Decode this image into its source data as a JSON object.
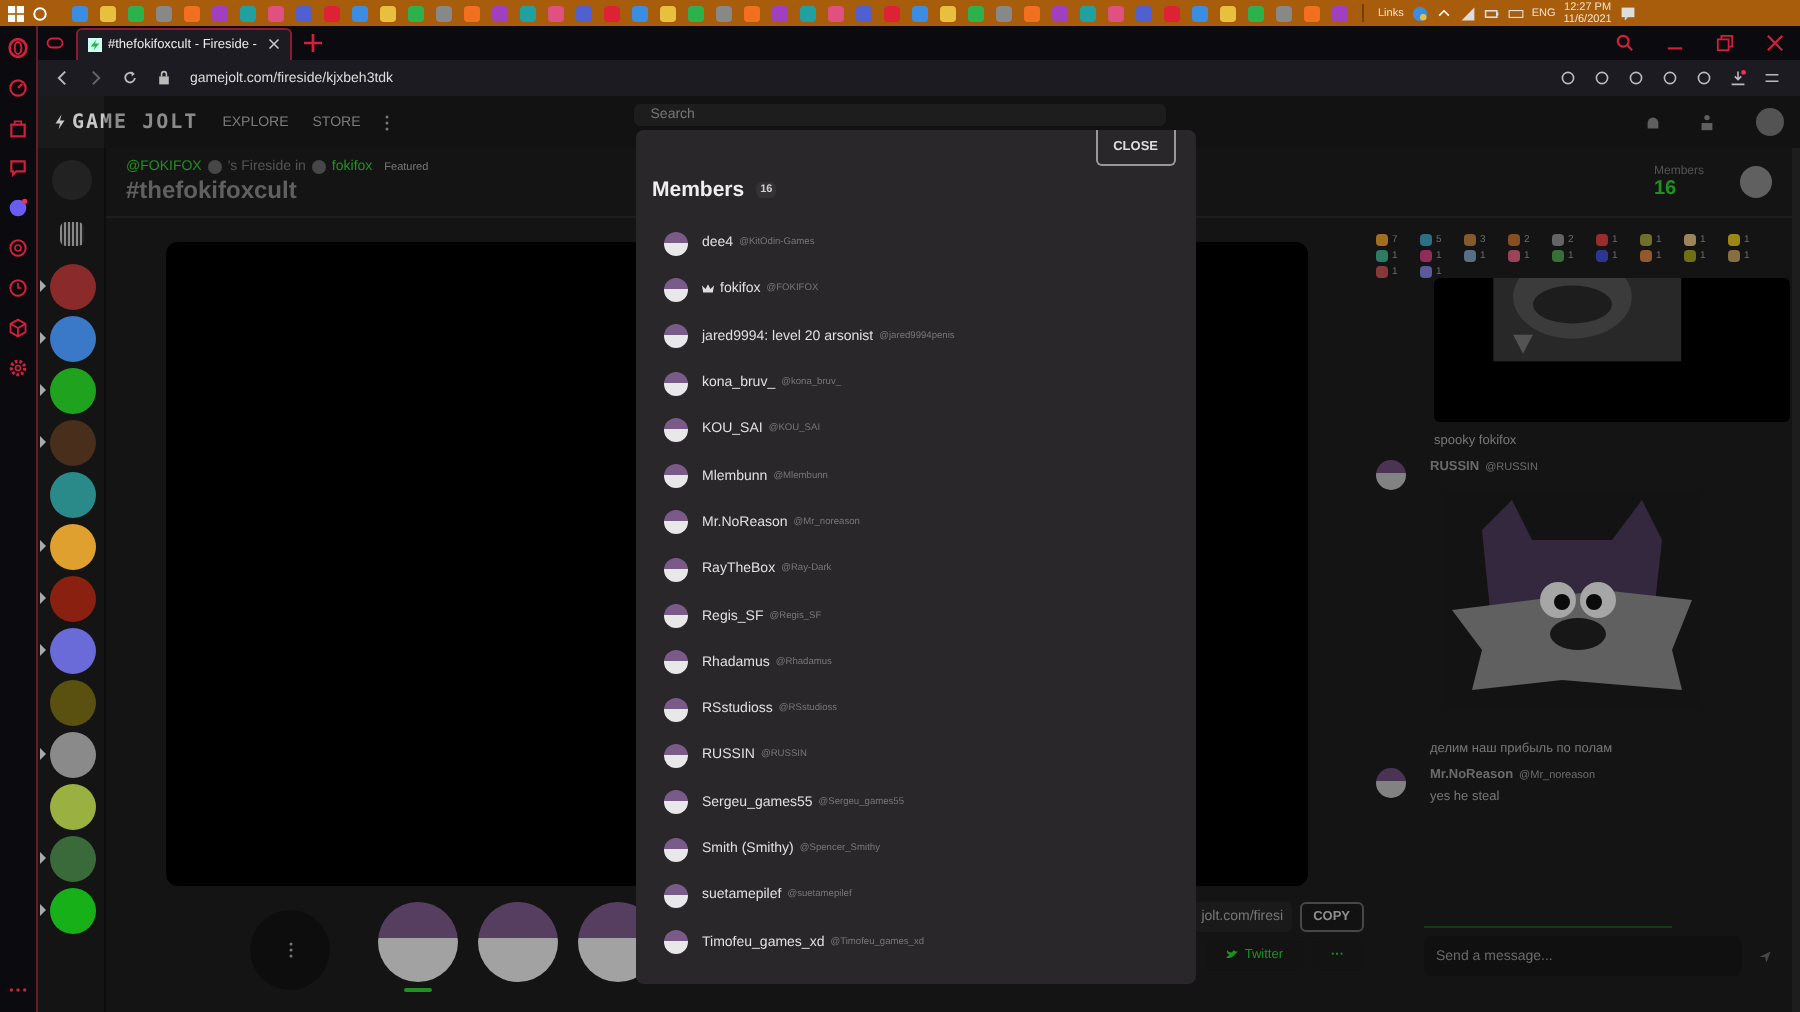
{
  "taskbar": {
    "links": "Links",
    "language": "ENG",
    "time": "12:27 PM",
    "date": "11/6/2021"
  },
  "browser": {
    "tab_title": "#thefokifoxcult - Fireside -",
    "url": "gamejolt.com/fireside/kjxbeh3tdk"
  },
  "site_header": {
    "logo": "GAME JOLT",
    "nav": [
      "EXPLORE",
      "STORE"
    ],
    "search": {
      "placeholder": "Search"
    }
  },
  "communities": [
    {
      "unread": true,
      "color": "#8a2a2a"
    },
    {
      "unread": true,
      "color": "#3a78c8"
    },
    {
      "unread": true,
      "color": "#1fa31f"
    },
    {
      "unread": true,
      "color": "#4a2e1c"
    },
    {
      "unread": false,
      "color": "#2a8a8a"
    },
    {
      "unread": true,
      "color": "#e0a030"
    },
    {
      "unread": true,
      "color": "#8a2010"
    },
    {
      "unread": true,
      "color": "#6a6ad8"
    },
    {
      "unread": false,
      "color": "#5a5010"
    },
    {
      "unread": true,
      "color": "#8a8a8a"
    },
    {
      "unread": false,
      "color": "#9ab040"
    },
    {
      "unread": true,
      "color": "#3a6a3a"
    },
    {
      "unread": true,
      "color": "#18b018"
    }
  ],
  "fireside": {
    "owner": "@FOKIFOX",
    "owner_suffix": "'s Fireside in",
    "community": "fokifox",
    "badge": "Featured",
    "title": "#thefokifoxcult",
    "members_label": "Members",
    "members_count": "16"
  },
  "stream_participants": [
    {
      "selected": true
    },
    {
      "selected": false
    },
    {
      "selected": false
    }
  ],
  "share": {
    "url": "jolt.com/firesi",
    "copy": "COPY",
    "twitter": "Twitter",
    "more": "···"
  },
  "reactions": [
    {
      "count": "7"
    },
    {
      "count": "5"
    },
    {
      "count": "3"
    },
    {
      "count": "2"
    },
    {
      "count": "2"
    },
    {
      "count": "1"
    },
    {
      "count": "1"
    },
    {
      "count": "1"
    },
    {
      "count": "1"
    },
    {
      "count": "1"
    },
    {
      "count": "1"
    },
    {
      "count": "1"
    },
    {
      "count": "1"
    },
    {
      "count": "1"
    },
    {
      "count": "1"
    },
    {
      "count": "1"
    },
    {
      "count": "1"
    },
    {
      "count": "1"
    },
    {
      "count": "1"
    },
    {
      "count": "1"
    }
  ],
  "chat": [
    {
      "kind": "caption",
      "text": "spooky fokifox"
    },
    {
      "kind": "message",
      "name": "RUSSIN",
      "handle": "@RUSSIN",
      "image": true,
      "text": "делим наш прибыль по полам"
    },
    {
      "kind": "message",
      "name": "Mr.NoReason",
      "handle": "@Mr_noreason",
      "image": false,
      "text": "yes he steal"
    }
  ],
  "message_input": {
    "placeholder": "Send a message..."
  },
  "members_modal": {
    "title": "Members",
    "count": "16",
    "close": "CLOSE",
    "members": [
      {
        "name": "dee4",
        "handle": "@KitOdin-Games",
        "owner": false
      },
      {
        "name": "fokifox",
        "handle": "@FOKIFOX",
        "owner": true
      },
      {
        "name": "jared9994: level 20 arsonist",
        "handle": "@jared9994penis",
        "owner": false
      },
      {
        "name": "kona_bruv_",
        "handle": "@kona_bruv_",
        "owner": false
      },
      {
        "name": "KOU_SAI",
        "handle": "@KOU_SAI",
        "owner": false
      },
      {
        "name": "Mlembunn",
        "handle": "@Mlembunn",
        "owner": false
      },
      {
        "name": "Mr.NoReason",
        "handle": "@Mr_noreason",
        "owner": false
      },
      {
        "name": "RayTheBox",
        "handle": "@Ray-Dark",
        "owner": false
      },
      {
        "name": "Regis_SF",
        "handle": "@Regis_SF",
        "owner": false
      },
      {
        "name": "Rhadamus",
        "handle": "@Rhadamus",
        "owner": false
      },
      {
        "name": "RSstudioss",
        "handle": "@RSstudioss",
        "owner": false
      },
      {
        "name": "RUSSIN",
        "handle": "@RUSSIN",
        "owner": false
      },
      {
        "name": "Sergeu_games55",
        "handle": "@Sergeu_games55",
        "owner": false
      },
      {
        "name": "Smith (Smithy)",
        "handle": "@Spencer_Smithy",
        "owner": false
      },
      {
        "name": "suetamepilef",
        "handle": "@suetamepilef",
        "owner": false
      },
      {
        "name": "Timofeu_games_xd",
        "handle": "@Timofeu_games_xd",
        "owner": false
      }
    ]
  }
}
